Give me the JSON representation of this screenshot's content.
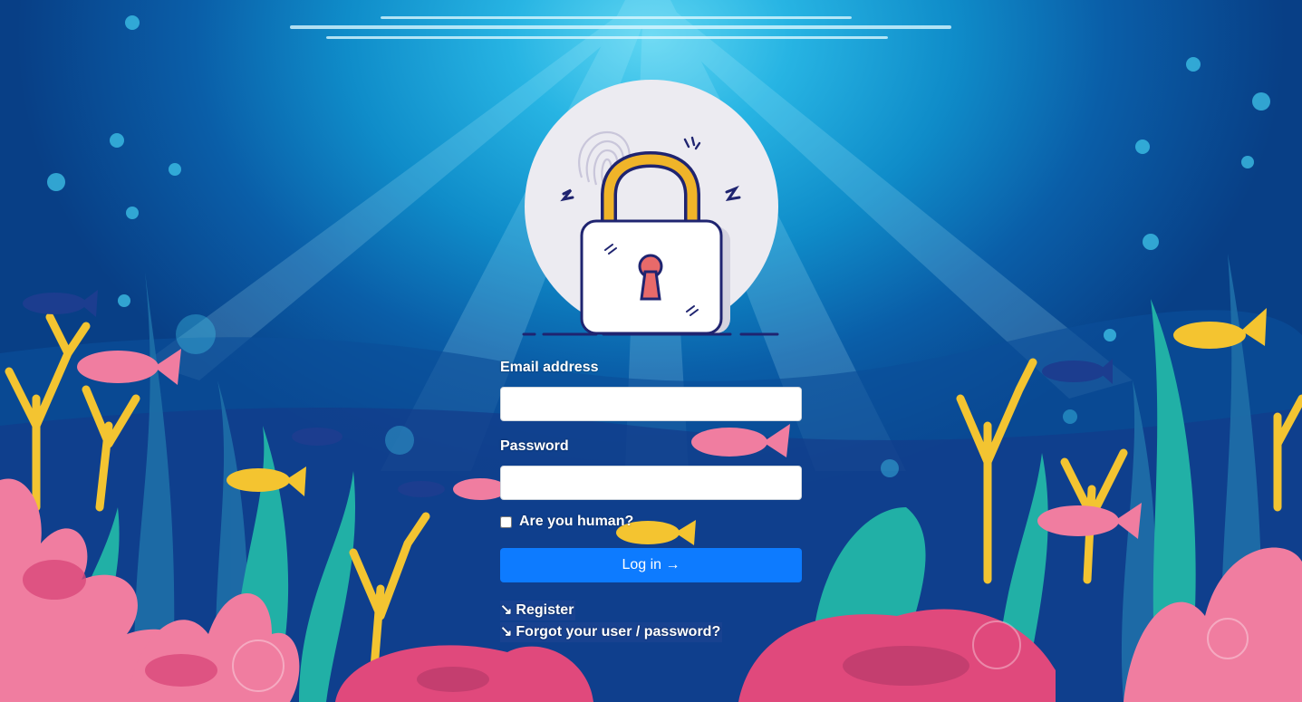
{
  "login": {
    "email_label": "Email address",
    "email_value": "",
    "password_label": "Password",
    "password_value": "",
    "human_check_label": "Are you human?",
    "human_checked": false,
    "login_button": "Log in →"
  },
  "links": {
    "arrow_glyph": "↘",
    "register": "Register",
    "forgot": "Forgot your user / password?"
  },
  "icons": {
    "hero": "padlock-fingerprint-icon"
  },
  "colors": {
    "button": "#0d7bff",
    "padlock_shackle": "#f0b429",
    "padlock_outline": "#1f2470",
    "keyhole": "#e86a6a"
  }
}
